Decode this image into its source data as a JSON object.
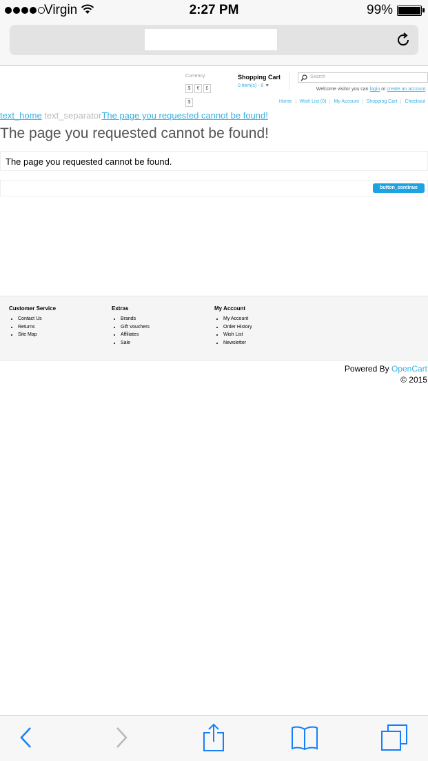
{
  "status_bar": {
    "carrier": "Virgin",
    "time": "2:27 PM",
    "battery_percent": "99%",
    "signal_bars_filled": 4,
    "signal_bars_total": 5
  },
  "header": {
    "currency_label": "Currency",
    "currency_options": [
      "$",
      "€",
      "£",
      "$"
    ],
    "cart_title": "Shopping Cart",
    "cart_items": "0 item(s) - 0",
    "search_placeholder": "Search",
    "welcome_prefix": "Welcome visitor you can",
    "login_link": "login",
    "welcome_or": "or",
    "create_account_link": "create an account",
    "welcome_suffix": ".",
    "top_links": [
      "Home",
      "Wish List (0)",
      "My Account",
      "Shopping Cart",
      "Checkout"
    ]
  },
  "breadcrumb": {
    "home": "text_home",
    "separator": "text_separator",
    "current": "The page you requested cannot be found!"
  },
  "main": {
    "title": "The page you requested cannot be found!",
    "message": "The page you requested cannot be found.",
    "continue_button": "button_continue"
  },
  "footer": {
    "columns": [
      {
        "heading": "Customer Service",
        "items": [
          "Contact Us",
          "Returns",
          "Site Map"
        ]
      },
      {
        "heading": "Extras",
        "items": [
          "Brands",
          "Gift Vouchers",
          "Affiliates",
          "Sale"
        ]
      },
      {
        "heading": "My Account",
        "items": [
          "My Account",
          "Order History",
          "Wish List",
          "Newsletter"
        ]
      }
    ],
    "powered_by": "Powered By",
    "powered_link": "OpenCart",
    "copyright": "© 2015"
  },
  "toolbar": {
    "icons": [
      "back-icon",
      "forward-icon",
      "share-icon",
      "bookmarks-icon",
      "tabs-icon"
    ]
  },
  "colors": {
    "link": "#38b0e3",
    "button": "#1ea3e2",
    "ios_blue": "#157efb"
  }
}
